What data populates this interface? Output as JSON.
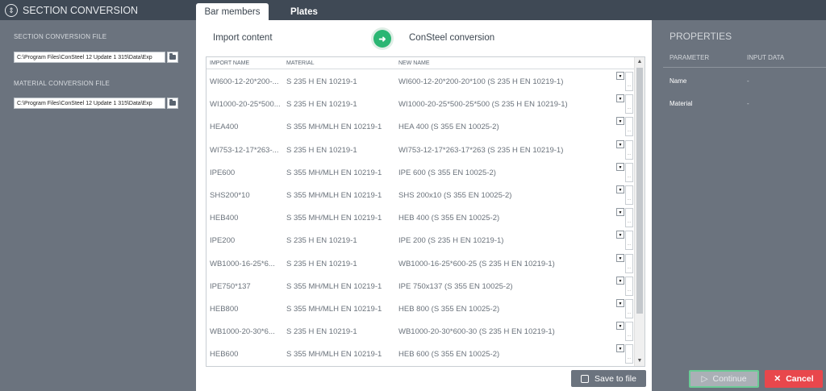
{
  "app": {
    "title": "SECTION CONVERSION"
  },
  "tabs": [
    {
      "label": "Bar members"
    },
    {
      "label": "Plates"
    }
  ],
  "left": {
    "section_label": "SECTION CONVERSION FILE",
    "section_path": "C:\\Program Files\\ConSteel 12 Update 1 315\\Data\\Exp",
    "material_label": "MATERIAL CONVERSION FILE",
    "material_path": "C:\\Program Files\\ConSteel 12 Update 1 315\\Data\\Exp"
  },
  "center": {
    "import_label": "Import content",
    "conversion_label": "ConSteel conversion",
    "save_label": "Save to file",
    "columns": [
      "IMPORT NAME",
      "MATERIAL",
      "NEW NAME"
    ],
    "rows": [
      {
        "import": "WI600-12-20*200-...",
        "material": "S 235 H EN 10219-1",
        "new": "WI600-12-20*200-20*100 (S 235 H EN 10219-1)"
      },
      {
        "import": "WI1000-20-25*500...",
        "material": "S 235 H EN 10219-1",
        "new": "WI1000-20-25*500-25*500 (S 235 H EN 10219-1)"
      },
      {
        "import": "HEA400",
        "material": "S 355 MH/MLH EN 10219-1",
        "new": "HEA 400 (S 355 EN 10025-2)"
      },
      {
        "import": "WI753-12-17*263-...",
        "material": "S 235 H EN 10219-1",
        "new": "WI753-12-17*263-17*263 (S 235 H EN 10219-1)"
      },
      {
        "import": "IPE600",
        "material": "S 355 MH/MLH EN 10219-1",
        "new": "IPE 600 (S 355 EN 10025-2)"
      },
      {
        "import": "SHS200*10",
        "material": "S 355 MH/MLH EN 10219-1",
        "new": "SHS 200x10 (S 355 EN 10025-2)"
      },
      {
        "import": "HEB400",
        "material": "S 355 MH/MLH EN 10219-1",
        "new": "HEB 400 (S 355 EN 10025-2)"
      },
      {
        "import": "IPE200",
        "material": "S 235 H EN 10219-1",
        "new": "IPE 200 (S 235 H EN 10219-1)"
      },
      {
        "import": "WB1000-16-25*6...",
        "material": "S 235 H EN 10219-1",
        "new": "WB1000-16-25*600-25 (S 235 H EN 10219-1)"
      },
      {
        "import": "IPE750*137",
        "material": "S 355 MH/MLH EN 10219-1",
        "new": "IPE 750x137 (S 355 EN 10025-2)"
      },
      {
        "import": "HEB800",
        "material": "S 355 MH/MLH EN 10219-1",
        "new": "HEB 800 (S 355 EN 10025-2)"
      },
      {
        "import": "WB1000-20-30*6...",
        "material": "S 235 H EN 10219-1",
        "new": "WB1000-20-30*600-30 (S 235 H EN 10219-1)"
      },
      {
        "import": "HEB600",
        "material": "S 355 MH/MLH EN 10219-1",
        "new": "HEB 600 (S 355 EN 10025-2)"
      }
    ]
  },
  "properties": {
    "title": "PROPERTIES",
    "col_param": "PARAMETER",
    "col_input": "INPUT DATA",
    "name_label": "Name",
    "name_value": "-",
    "material_label": "Material",
    "material_value": "-"
  },
  "buttons": {
    "continue": "Continue",
    "cancel": "Cancel"
  },
  "icons": {
    "app": "section-conversion-icon",
    "arrow": "arrow-right-icon",
    "save": "save-icon",
    "continue": "play-icon",
    "cancel": "close-icon",
    "browse": "folder-icon",
    "dropdown": "dropdown-arrow-icon"
  },
  "colors": {
    "accent_green": "#2bb673",
    "cancel_red": "#e8474c",
    "topbar": "#3f4955",
    "panel": "#6b737e"
  }
}
